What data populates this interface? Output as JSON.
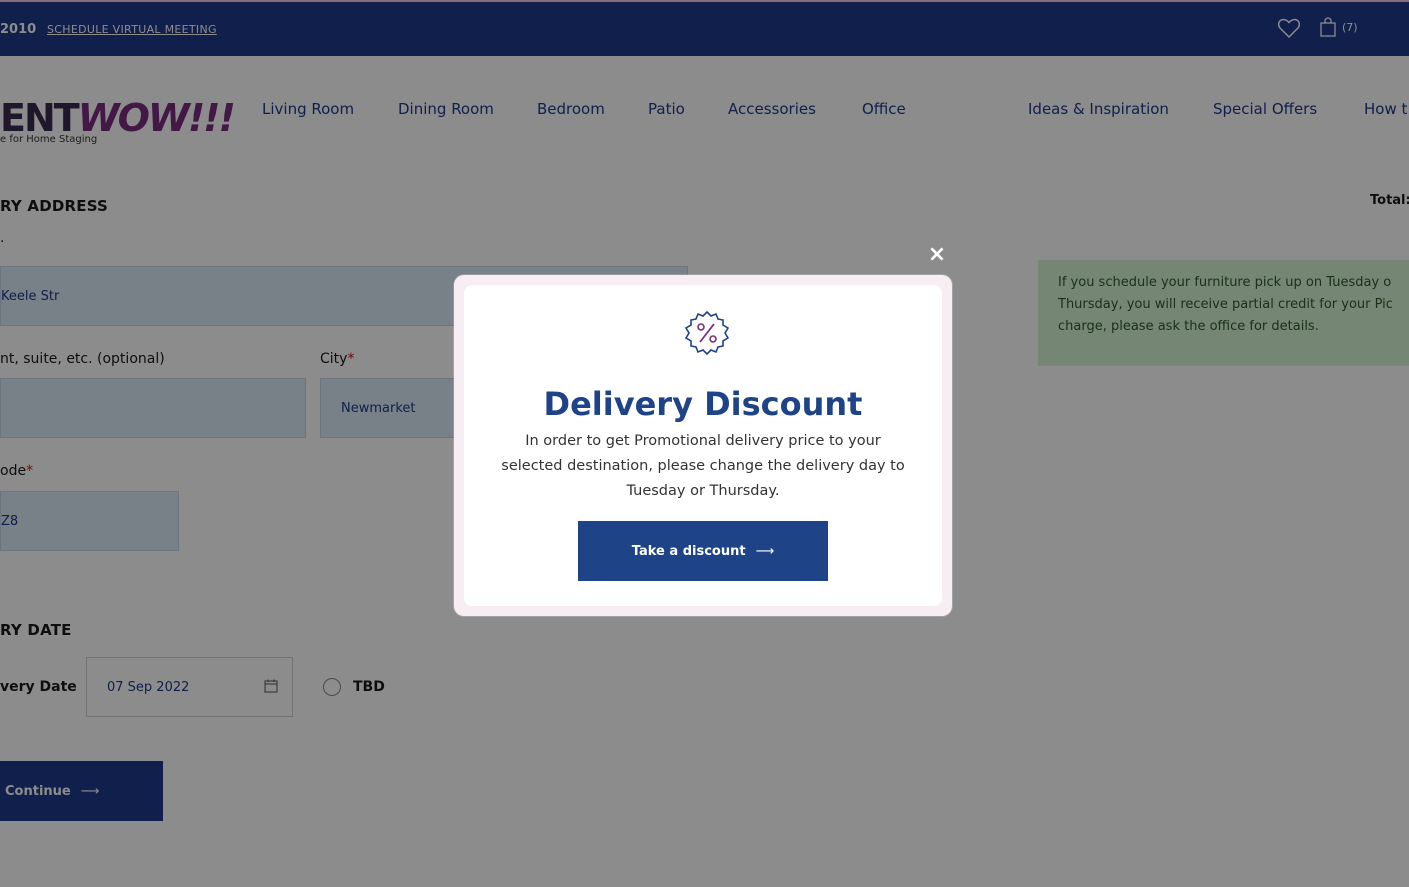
{
  "topbar": {
    "phone": "2010",
    "schedule_link": "SCHEDULE VIRTUAL MEETING",
    "cart_count": "(7)"
  },
  "logo": {
    "text_dark": "ENT",
    "text_accent": "WOW!!!",
    "tagline": "e for Home Staging"
  },
  "nav": {
    "items": [
      "Living Room",
      "Dining Room",
      "Bedroom",
      "Patio",
      "Accessories",
      "Office",
      "Ideas & Inspiration",
      "Special Offers",
      "How t"
    ]
  },
  "form": {
    "address_title": "RY ADDRESS",
    "address_label": ".",
    "address_value": "Keele Str",
    "apt_label": "nt, suite, etc. (optional)",
    "apt_value": "",
    "city_label": "City",
    "city_value": "Newmarket",
    "postal_label": "ode",
    "postal_value": "Z8",
    "date_title": "RY DATE",
    "date_label": "very Date",
    "date_value": "07 Sep 2022",
    "tbd_label": "TBD",
    "continue_label": "Continue"
  },
  "summary": {
    "total_label": "Total:",
    "info_text_1": "If you schedule your furniture pick up on Tuesday o",
    "info_text_2": "Thursday, you will receive partial credit for your Pic",
    "info_text_3": "charge, please ask the office for details."
  },
  "modal": {
    "close_label": "×",
    "title": "Delivery Discount",
    "body_line_1": "In order to get Promotional delivery price to your",
    "body_line_2": "selected destination, please change the delivery day to",
    "body_line_3": "Tuesday or Thursday.",
    "button_label": "Take a discount",
    "arrow": "⟶"
  },
  "colors": {
    "primary": "#1e3a8a",
    "modal_title": "#1e4487",
    "field_bg": "#dbe9f7",
    "info_bg": "#d7f5d4",
    "required": "#dd1111"
  },
  "icons": [
    "heart-icon",
    "shopping-bag-icon",
    "calendar-icon",
    "percent-badge-icon",
    "close-icon",
    "arrow-right-icon"
  ]
}
